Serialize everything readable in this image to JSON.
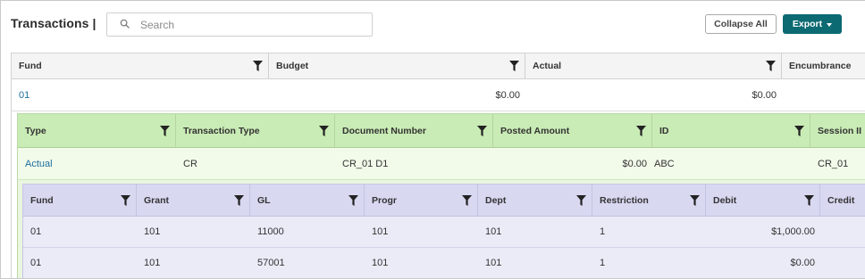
{
  "header": {
    "title": "Transactions |",
    "search_placeholder": "Search",
    "search_value": "",
    "collapse_label": "Collapse All",
    "export_label": "Export"
  },
  "level1": {
    "columns": [
      "Fund",
      "Budget",
      "Actual",
      "Encumbrance"
    ],
    "rows": [
      {
        "fund": "01",
        "budget": "$0.00",
        "actual": "$0.00",
        "encumbrance": ""
      }
    ]
  },
  "level2": {
    "columns": [
      "Type",
      "Transaction Type",
      "Document Number",
      "Posted Amount",
      "ID",
      "Session II"
    ],
    "rows": [
      {
        "type": "Actual",
        "transaction_type": "CR",
        "document_number": "CR_01 D1",
        "posted_amount": "$0.00",
        "id": "ABC",
        "session": "CR_01"
      }
    ]
  },
  "level3": {
    "columns": [
      "Fund",
      "Grant",
      "GL",
      "Progr",
      "Dept",
      "Restriction",
      "Debit",
      "Credit"
    ],
    "rows": [
      {
        "fund": "01",
        "grant": "101",
        "gl": "11000",
        "progr": "101",
        "dept": "101",
        "restriction": "1",
        "debit": "$1,000.00",
        "credit": ""
      },
      {
        "fund": "01",
        "grant": "101",
        "gl": "57001",
        "progr": "101",
        "dept": "101",
        "restriction": "1",
        "debit": "$0.00",
        "credit": ""
      }
    ]
  },
  "colors": {
    "export_button": "#0c6a72",
    "link": "#1e6f9f",
    "level2_header": "#c9ebb5",
    "level3_header": "#d8d8f1"
  },
  "icons": {
    "search": "search-icon",
    "filter": "filter-icon",
    "export_caret": "caret-down-icon"
  }
}
